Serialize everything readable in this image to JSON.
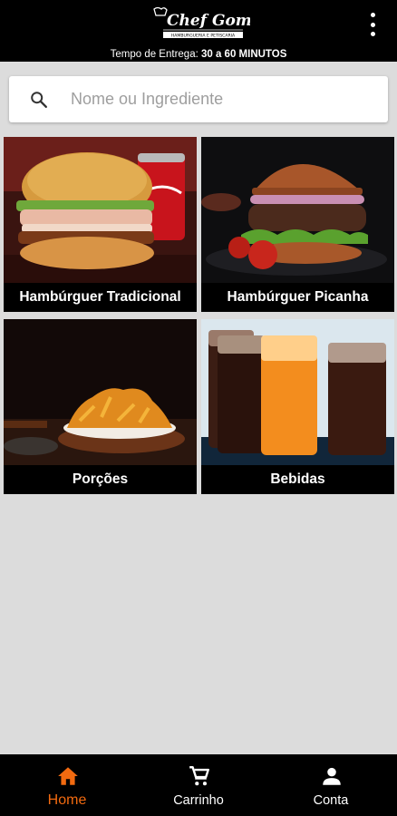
{
  "header": {
    "logo_text": "Chef Gomes",
    "logo_subtext": "HAMBURGUERIA E PETISCARIA",
    "delivery_label": "Tempo de Entrega:",
    "delivery_value": "30 a 60 MINUTOS"
  },
  "search": {
    "placeholder": "Nome ou Ingrediente",
    "value": ""
  },
  "categories": [
    {
      "label": "Hambúrguer Tradicional",
      "photo_icon": "burger-photo"
    },
    {
      "label": "Hambúrguer Picanha",
      "photo_icon": "burger-photo"
    },
    {
      "label": "Porções",
      "photo_icon": "fries-photo"
    },
    {
      "label": "Bebidas",
      "photo_icon": "drinks-photo"
    }
  ],
  "nav": {
    "items": [
      {
        "label": "Home",
        "icon": "home-icon",
        "active": true
      },
      {
        "label": "Carrinho",
        "icon": "cart-icon",
        "active": false
      },
      {
        "label": "Conta",
        "icon": "person-icon",
        "active": false
      }
    ]
  },
  "colors": {
    "accent": "#f26a10",
    "bars": "#000000",
    "background": "#dcdcdc"
  }
}
